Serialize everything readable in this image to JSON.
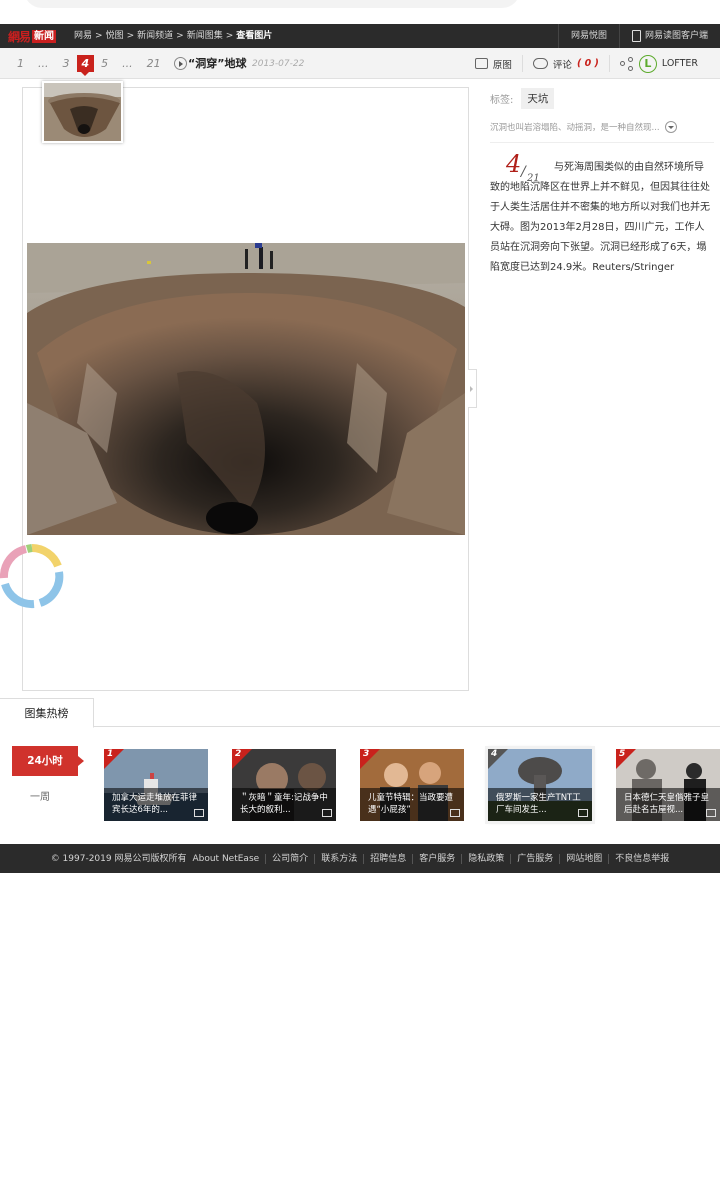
{
  "topbar": {
    "logo_wy": "網易",
    "logo_xw": "新闻",
    "crumbs": [
      "网易",
      ">",
      "悦图",
      ">",
      "新闻频道",
      ">",
      "新闻图集",
      ">"
    ],
    "crumb_current": "查看图片",
    "right_items": [
      "网易悦图",
      "网易读图客户端"
    ]
  },
  "pager": {
    "pages": [
      "1",
      "...",
      "3",
      "4",
      "5",
      "...",
      "21"
    ],
    "active_page": "4",
    "title": "“洞穿”地球",
    "date": "2013-07-22"
  },
  "tools": {
    "original": "原图",
    "comment": "评论",
    "comment_count": "( 0 )",
    "lofter_letter": "L",
    "lofter": "LOFTER"
  },
  "info": {
    "tags_label": "标签:",
    "tag": "天坑",
    "summary": "沉洞也叫岩溶塌陷、动摇洞，是一种自然现...",
    "counter_num": "4",
    "counter_total": "21",
    "description": "与死海周围类似的由自然环境所导致的地陷沉降区在世界上并不鲜见，但因其往往处于人类生活居住并不密集的地方所以对我们也并无大碍。图为2013年2月28日，四川广元，工作人员站在沉洞旁向下张望。沉洞已经形成了6天，塌陷宽度已达到24.9米。Reuters/Stringer"
  },
  "hot": {
    "tab": "图集热榜",
    "period_active": "24小时",
    "period_week": "一周",
    "items": [
      {
        "rank": "1",
        "caption": "加拿大运走堆放在菲律宾长达6年的..."
      },
      {
        "rank": "2",
        "caption": "＂灰暗＂童年:记战争中长大的叙利..."
      },
      {
        "rank": "3",
        "caption": "儿童节特辑：当政要遭遇“小屁孩”"
      },
      {
        "rank": "4",
        "caption": "俄罗斯一家生产TNT工厂车间发生..."
      },
      {
        "rank": "5",
        "caption": "日本德仁天皇偕雅子皇后赴名古屋视..."
      }
    ]
  },
  "footer": {
    "copyright": "© 1997-2019 网易公司版权所有",
    "links": [
      "About NetEase",
      "公司简介",
      "联系方法",
      "招聘信息",
      "客户服务",
      "隐私政策",
      "广告服务",
      "网站地图",
      "不良信息举报"
    ]
  },
  "colors": {
    "brand_red": "#c9221c",
    "dark_bar": "#2b2b2b",
    "lofter_green": "#5dab2d"
  }
}
